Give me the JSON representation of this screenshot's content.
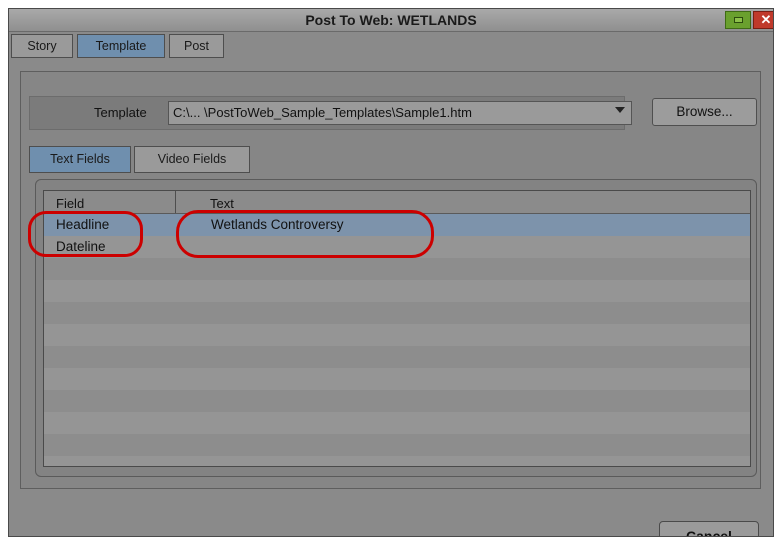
{
  "window": {
    "title": "Post To Web: WETLANDS",
    "close_glyph": "✕"
  },
  "top_tabs": [
    {
      "label": "Story"
    },
    {
      "label": "Template"
    },
    {
      "label": "Post"
    }
  ],
  "template": {
    "label": "Template",
    "path": "C:\\... \\PostToWeb_Sample_Templates\\Sample1.htm",
    "browse_label": "Browse..."
  },
  "sub_tabs": [
    {
      "label": "Text Fields"
    },
    {
      "label": "Video Fields"
    }
  ],
  "table": {
    "columns": [
      "Field",
      "Text"
    ],
    "rows": [
      {
        "field": "Headline",
        "text": "Wetlands Controversy"
      },
      {
        "field": "Dateline",
        "text": ""
      }
    ]
  },
  "footer": {
    "cancel_label": "Cancel"
  },
  "colors": {
    "annotation": "#cc0000",
    "active_tab": "#6f8fae",
    "selected_row": "#7d93ab"
  }
}
